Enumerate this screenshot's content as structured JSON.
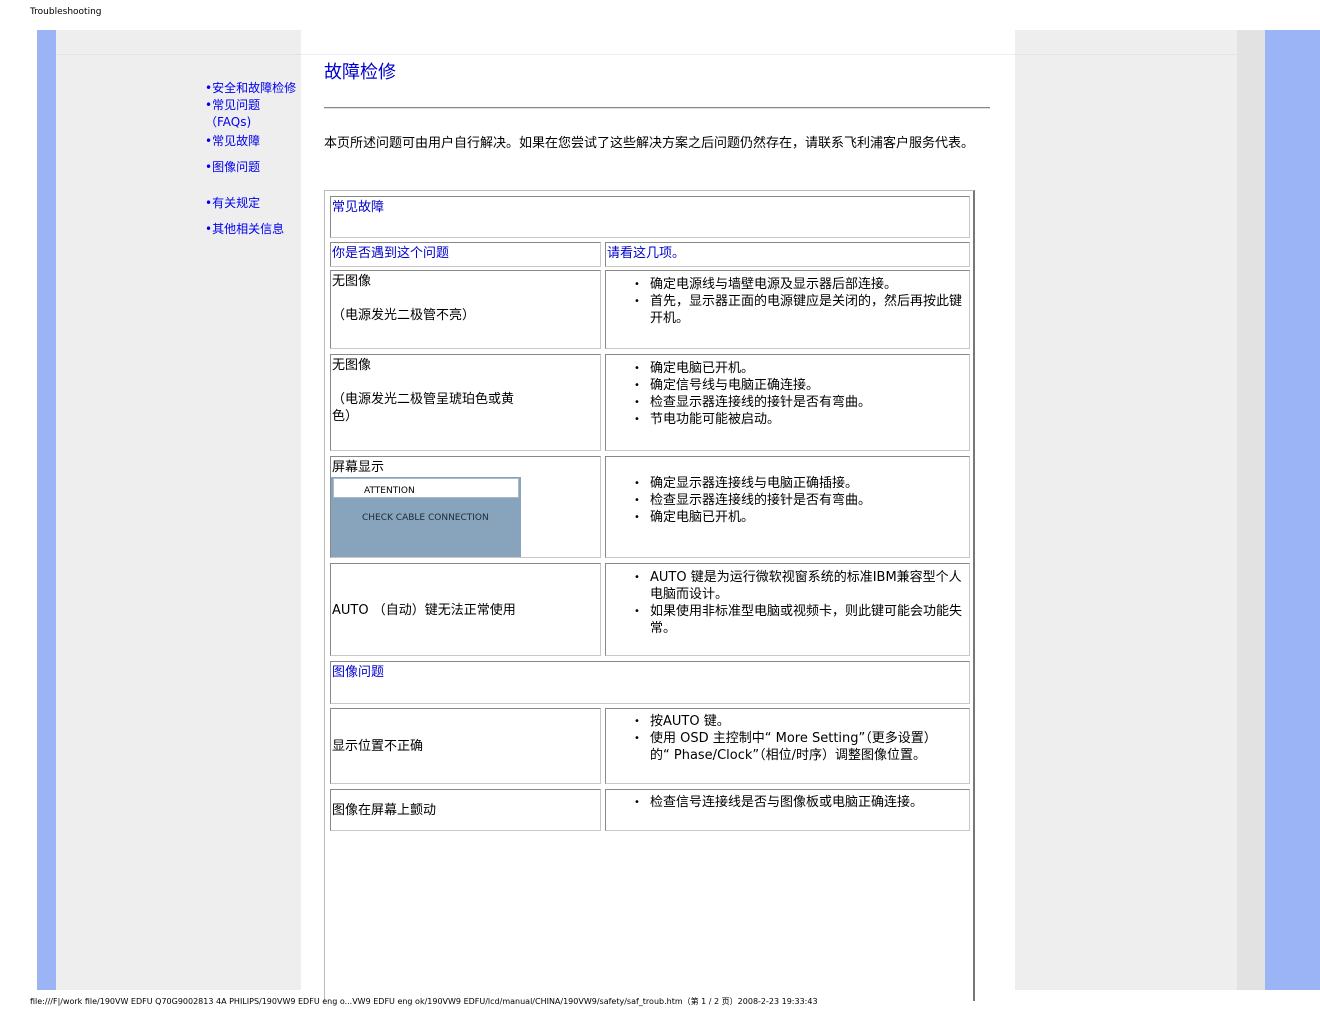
{
  "browser": {
    "tab_title": "Troubleshooting",
    "footer_path": "file:///F|/work file/190VW EDFU Q70G9002813 4A PHILIPS/190VW9 EDFU eng o...VW9 EDFU eng ok/190VW9 EDFU/lcd/manual/CHINA/190VW9/safety/saf_troub.htm（第 1 / 2 页）2008-2-23 19:33:43"
  },
  "sidebar": {
    "items": [
      {
        "label": "•安全和故障检修"
      },
      {
        "label": "•常见问题（FAQs)"
      },
      {
        "label": "•常见故障"
      },
      {
        "label": "•图像问题"
      },
      {
        "label": "•有关规定"
      },
      {
        "label": "•其他相关信息"
      }
    ]
  },
  "main": {
    "title": "故障检修",
    "intro": "本页所述问题可由用户自行解决。如果在您尝试了这些解决方案之后问题仍然存在，请联系飞利浦客户服务代表。",
    "common_section": "常见故障",
    "col_problem": "你是否遇到这个问题",
    "col_check": "请看这几项。",
    "rows": [
      {
        "problem_line1": "无图像",
        "problem_line2": "（电源发光二极管不亮）",
        "checks": [
          "确定电源线与墙壁电源及显示器后部连接。",
          "首先，显示器正面的电源键应是关闭的，然后再按此键开机。"
        ]
      },
      {
        "problem_line1": "无图像",
        "problem_line2": "（电源发光二极管呈琥珀色或黄色）",
        "checks": [
          "确定电脑已开机。",
          "确定信号线与电脑正确连接。",
          "检查显示器连接线的接针是否有弯曲。",
          "节电功能可能被启动。"
        ]
      },
      {
        "problem_line1": "屏幕显示",
        "attention_title": "ATTENTION",
        "attention_message": "CHECK CABLE CONNECTION",
        "checks": [
          "确定显示器连接线与电脑正确插接。",
          "检查显示器连接线的接针是否有弯曲。",
          "确定电脑已开机。"
        ]
      },
      {
        "problem_line1": "AUTO （自动）键无法正常使用",
        "checks": [
          "AUTO 键是为运行微软视窗系统的标准IBM兼容型个人电脑而设计。",
          "如果使用非标准型电脑或视频卡，则此键可能会功能失常。"
        ]
      }
    ],
    "image_section": "图像问题",
    "image_rows": [
      {
        "problem_line1": "显示位置不正确",
        "checks": [
          "按AUTO 键。",
          "使用 OSD 主控制中“ More Setting”（更多设置）的“ Phase/Clock”（相位/时序）调整图像位置。"
        ]
      },
      {
        "problem_line1": "图像在屏幕上颤动",
        "checks": [
          "检查信号连接线是否与图像板或电脑正确连接。"
        ]
      }
    ]
  }
}
